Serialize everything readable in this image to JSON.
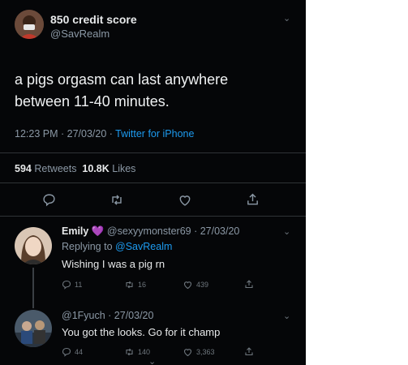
{
  "main_tweet": {
    "display_name": "850 credit score",
    "handle": "@SavRealm",
    "text_line1": "a pigs orgasm can last anywhere",
    "text_line2": "between 11-40 minutes.",
    "time": "12:23 PM · 27/03/20 · ",
    "client": "Twitter for iPhone",
    "retweets_count": "594",
    "retweets_label": "Retweets",
    "likes_count": "10.8K",
    "likes_label": "Likes",
    "actions": [
      "reply-icon",
      "retweet-icon",
      "like-icon",
      "share-icon"
    ]
  },
  "reply1": {
    "display_name": "Emily",
    "emoji": "💜",
    "handle_date": "@sexyymonster69 · 27/03/20",
    "replying_prefix": "Replying to",
    "replying_handle": "@SavRealm",
    "text": "Wishing I was a pig rn",
    "reply_count": "11",
    "retweet_count": "16",
    "like_count": "439"
  },
  "reply2": {
    "handle_date": "@1Fyuch · 27/03/20",
    "text": "You got the looks. Go for it champ",
    "reply_count": "44",
    "retweet_count": "140",
    "like_count": "3,363"
  },
  "colors": {
    "background": "#050608",
    "accent": "#1d9bf0",
    "heart": "#c264fe"
  }
}
